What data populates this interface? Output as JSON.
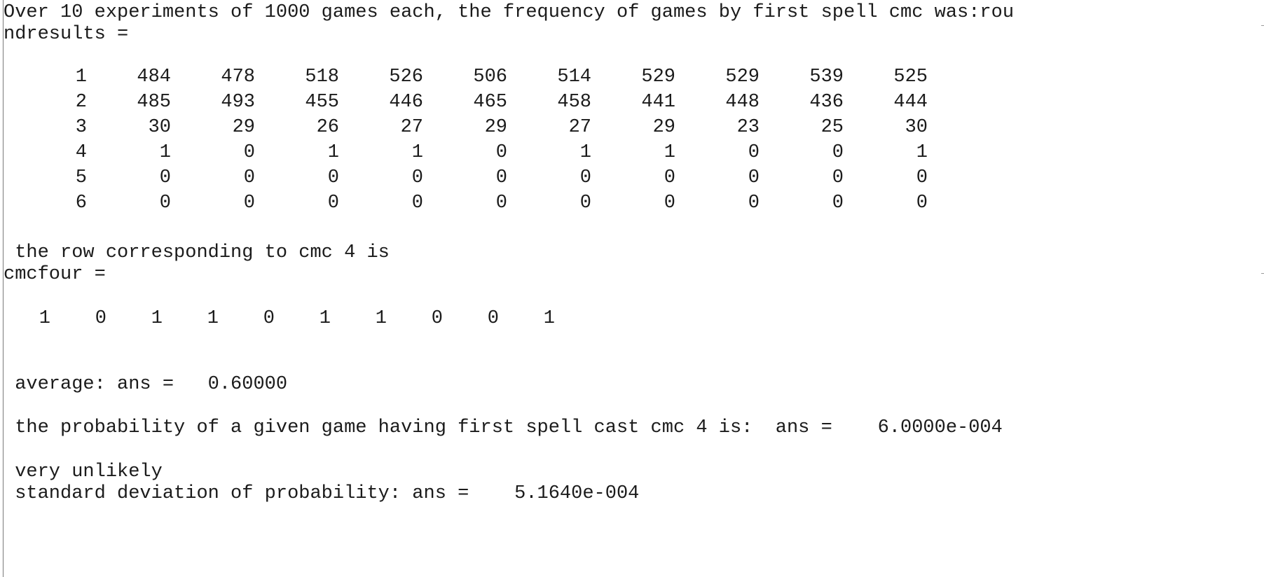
{
  "console": {
    "header_line1": "Over 10 experiments of 1000 games each, the frequency of games by first spell cmc was:rou",
    "header_line2": "ndresults =",
    "results_matrix": [
      [
        "1",
        "484",
        "478",
        "518",
        "526",
        "506",
        "514",
        "529",
        "529",
        "539",
        "525"
      ],
      [
        "2",
        "485",
        "493",
        "455",
        "446",
        "465",
        "458",
        "441",
        "448",
        "436",
        "444"
      ],
      [
        "3",
        "30",
        "29",
        "26",
        "27",
        "29",
        "27",
        "29",
        "23",
        "25",
        "30"
      ],
      [
        "4",
        "1",
        "0",
        "1",
        "1",
        "0",
        "1",
        "1",
        "0",
        "0",
        "1"
      ],
      [
        "5",
        "0",
        "0",
        "0",
        "0",
        "0",
        "0",
        "0",
        "0",
        "0",
        "0"
      ],
      [
        "6",
        "0",
        "0",
        "0",
        "0",
        "0",
        "0",
        "0",
        "0",
        "0",
        "0"
      ]
    ],
    "row_text": " the row corresponding to cmc 4 is",
    "cmcfour_label": "cmcfour =",
    "cmcfour_values": [
      "1",
      "0",
      "1",
      "1",
      "0",
      "1",
      "1",
      "0",
      "0",
      "1"
    ],
    "average_text": " average: ans =   0.60000",
    "probability_text": " the probability of a given game having first spell cast cmc 4 is:  ans =    6.0000e-004",
    "unlikely_text": " very unlikely",
    "stddev_text": " standard deviation of probability: ans =    5.1640e-004"
  }
}
